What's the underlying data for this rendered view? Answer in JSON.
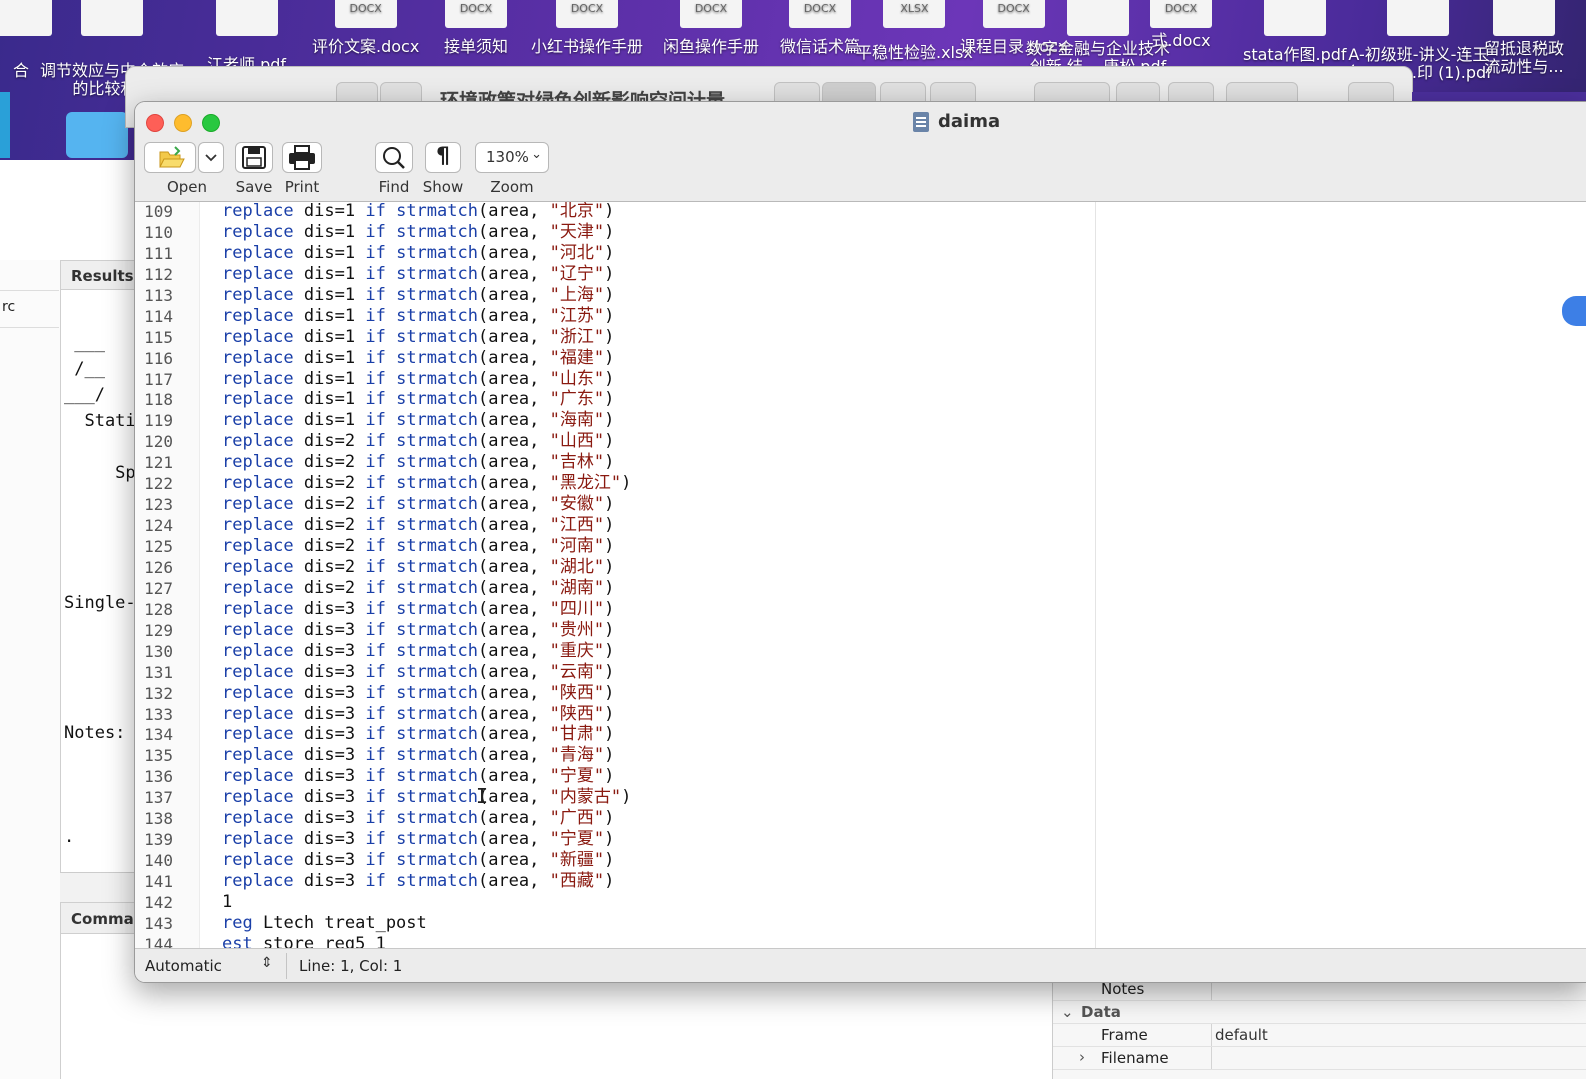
{
  "desktop": {
    "files": [
      {
        "label": "合",
        "thumb": ""
      },
      {
        "label": "调节效应与中介效应\n的比较和...",
        "thumb": ""
      },
      {
        "label": "江老师.pdf",
        "thumb": ""
      },
      {
        "label": "评价文案.docx",
        "thumb": "DOCX"
      },
      {
        "label": "接单须知",
        "thumb": "DOCX"
      },
      {
        "label": "小红书操作手册",
        "thumb": "DOCX"
      },
      {
        "label": "闲鱼操作手册",
        "thumb": "DOCX"
      },
      {
        "label": "微信话术篇",
        "thumb": "DOCX"
      },
      {
        "label": "平稳性检验.xlsx",
        "thumb": "XLSX"
      },
      {
        "label": "课程目录.docx",
        "thumb": "DOCX"
      },
      {
        "label": "数字金融与企业技术\n创新 结... 唐松.pdf",
        "thumb": ""
      },
      {
        "label": "式.docx",
        "thumb": "DOCX"
      },
      {
        "label": "stata作图.pdf",
        "thumb": ""
      },
      {
        "label": "A-初级班-讲义-连玉\n会2022...印 (1).pdf",
        "thumb": ""
      },
      {
        "label": "留抵退税政\n流动性与...",
        "thumb": ""
      }
    ]
  },
  "finder": {
    "title": "环境政策对绿色创新影响空间计量"
  },
  "stata": {
    "left_row": "rc",
    "results_tab": "Results",
    "results_text": " ___\n /__\n___/\n  Stati\n\n     Sp\n\n\n\n\nSingle-\n\n\n\n\nNotes:\n\n\n\n.",
    "command_tab": "Comman",
    "properties": {
      "notes_label": "Notes",
      "data_section": "Data",
      "frame_label": "Frame",
      "frame_value": "default",
      "filename_label": "Filename"
    }
  },
  "editor": {
    "title": "daima",
    "toolbar": {
      "open": "Open",
      "save": "Save",
      "print": "Print",
      "find": "Find",
      "show": "Show",
      "zoom_label": "Zoom",
      "zoom_value": "130%"
    },
    "lines": [
      {
        "n": "109",
        "dis": "1",
        "area": "北京"
      },
      {
        "n": "110",
        "dis": "1",
        "area": "天津"
      },
      {
        "n": "111",
        "dis": "1",
        "area": "河北"
      },
      {
        "n": "112",
        "dis": "1",
        "area": "辽宁"
      },
      {
        "n": "113",
        "dis": "1",
        "area": "上海"
      },
      {
        "n": "114",
        "dis": "1",
        "area": "江苏"
      },
      {
        "n": "115",
        "dis": "1",
        "area": "浙江"
      },
      {
        "n": "116",
        "dis": "1",
        "area": "福建"
      },
      {
        "n": "117",
        "dis": "1",
        "area": "山东"
      },
      {
        "n": "118",
        "dis": "1",
        "area": "广东"
      },
      {
        "n": "119",
        "dis": "1",
        "area": "海南"
      },
      {
        "n": "120",
        "dis": "2",
        "area": "山西"
      },
      {
        "n": "121",
        "dis": "2",
        "area": "吉林"
      },
      {
        "n": "122",
        "dis": "2",
        "area": "黑龙江"
      },
      {
        "n": "123",
        "dis": "2",
        "area": "安徽"
      },
      {
        "n": "124",
        "dis": "2",
        "area": "江西"
      },
      {
        "n": "125",
        "dis": "2",
        "area": "河南"
      },
      {
        "n": "126",
        "dis": "2",
        "area": "湖北"
      },
      {
        "n": "127",
        "dis": "2",
        "area": "湖南"
      },
      {
        "n": "128",
        "dis": "3",
        "area": "四川"
      },
      {
        "n": "129",
        "dis": "3",
        "area": "贵州"
      },
      {
        "n": "130",
        "dis": "3",
        "area": "重庆"
      },
      {
        "n": "131",
        "dis": "3",
        "area": "云南"
      },
      {
        "n": "132",
        "dis": "3",
        "area": "陕西"
      },
      {
        "n": "133",
        "dis": "3",
        "area": "陕西"
      },
      {
        "n": "134",
        "dis": "3",
        "area": "甘肃"
      },
      {
        "n": "135",
        "dis": "3",
        "area": "青海"
      },
      {
        "n": "136",
        "dis": "3",
        "area": "宁夏"
      },
      {
        "n": "137",
        "dis": "3",
        "area": "内蒙古"
      },
      {
        "n": "138",
        "dis": "3",
        "area": "广西"
      },
      {
        "n": "139",
        "dis": "3",
        "area": "宁夏"
      },
      {
        "n": "140",
        "dis": "3",
        "area": "新疆"
      },
      {
        "n": "141",
        "dis": "3",
        "area": "西藏"
      }
    ],
    "tail_lines": [
      {
        "n": "142",
        "text": "1"
      },
      {
        "n": "143",
        "text": "reg Ltech treat_post"
      },
      {
        "n": "144",
        "text": "est store reg5_1"
      }
    ],
    "status": {
      "mode": "Automatic",
      "position": "Line: 1, Col: 1"
    }
  },
  "colors": {
    "keyword": "#1a3fa8",
    "string": "#8a1a10",
    "close": "#fe5f57",
    "minimize": "#febc2e",
    "maximize": "#28c840"
  }
}
